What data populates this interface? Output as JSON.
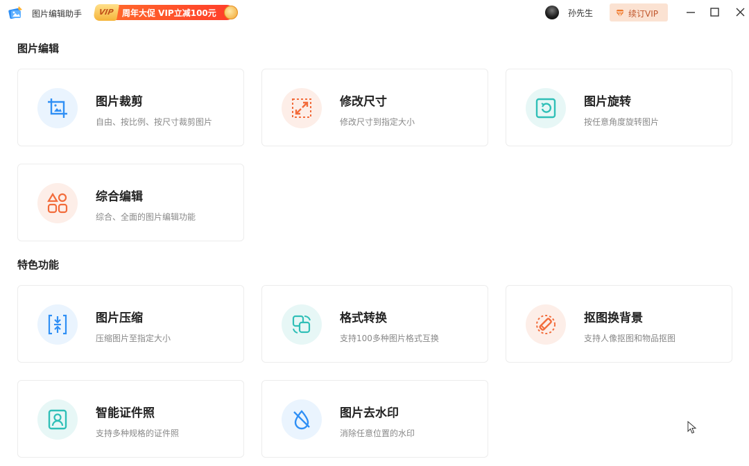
{
  "app": {
    "title": "图片编辑助手",
    "promo_vip": "VIP",
    "promo_text": "周年大促 VIP立减100元"
  },
  "user": {
    "name": "孙先生",
    "renew_label": "续订VIP"
  },
  "sections": {
    "edit_title": "图片编辑",
    "feature_title": "特色功能"
  },
  "cards": [
    {
      "title": "图片裁剪",
      "desc": "自由、按比例、按尺寸裁剪图片",
      "icon": "crop-icon"
    },
    {
      "title": "修改尺寸",
      "desc": "修改尺寸到指定大小",
      "icon": "resize-icon"
    },
    {
      "title": "图片旋转",
      "desc": "按任意角度旋转图片",
      "icon": "rotate-icon"
    },
    {
      "title": "综合编辑",
      "desc": "综合、全面的图片编辑功能",
      "icon": "shapes-icon"
    },
    {
      "title": "图片压缩",
      "desc": "压缩图片至指定大小",
      "icon": "compress-icon"
    },
    {
      "title": "格式转换",
      "desc": "支持100多种图片格式互换",
      "icon": "convert-icon"
    },
    {
      "title": "抠图换背景",
      "desc": "支持人像抠图和物品抠图",
      "icon": "cutout-icon"
    },
    {
      "title": "智能证件照",
      "desc": "支持多种规格的证件照",
      "icon": "id-photo-icon"
    },
    {
      "title": "图片去水印",
      "desc": "消除任意位置的水印",
      "icon": "remove-watermark-icon"
    }
  ],
  "colors": {
    "blue": "#2f8ff5",
    "orange": "#f26b3a",
    "teal": "#2fbfb7",
    "blue_bg": "#eaf4fe",
    "orange_bg": "#fdeee8",
    "teal_bg": "#e7f7f6"
  }
}
